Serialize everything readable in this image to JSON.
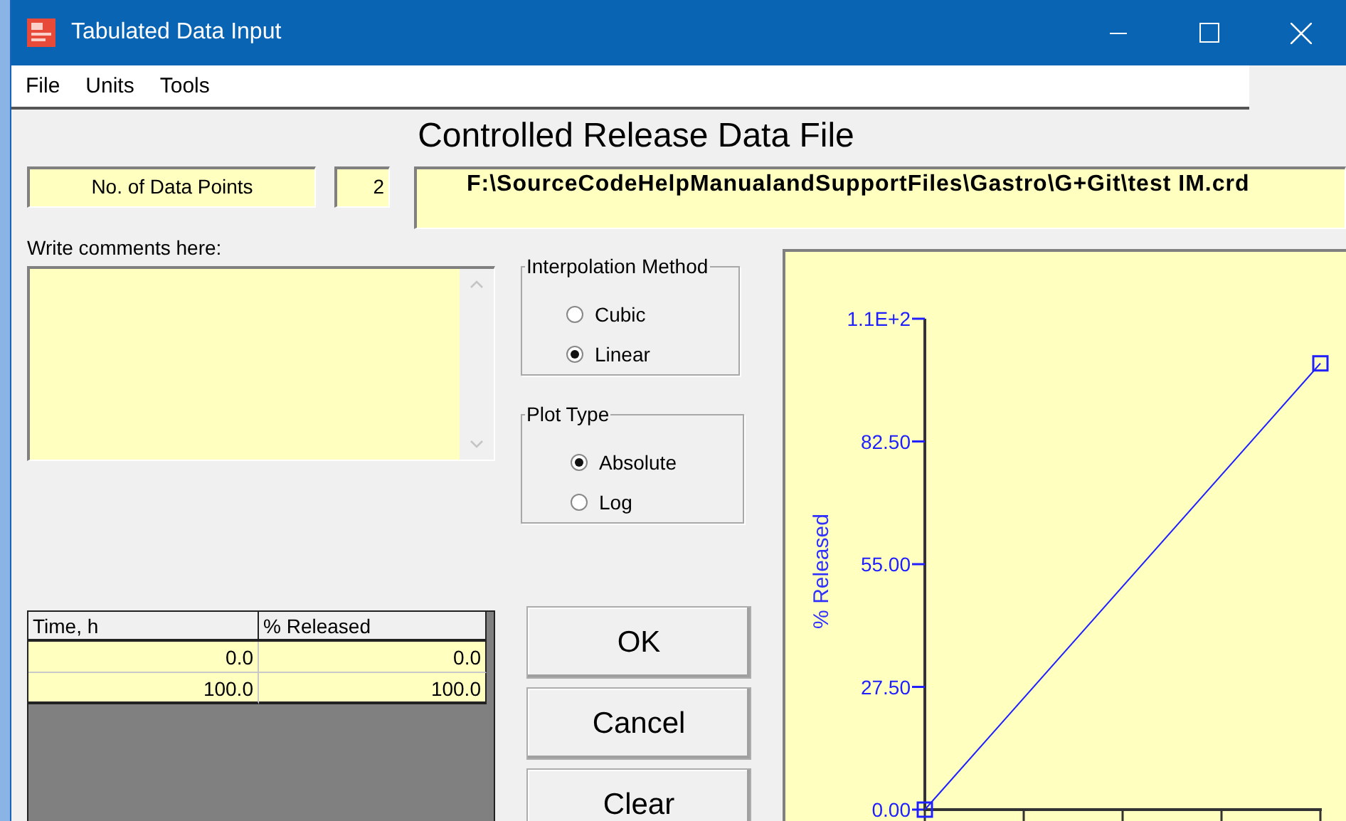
{
  "window": {
    "title": "Tabulated Data Input"
  },
  "menu": [
    {
      "label": "File"
    },
    {
      "label": "Units"
    },
    {
      "label": "Tools"
    }
  ],
  "heading": "Controlled Release Data File",
  "data_points": {
    "label": "No. of Data Points",
    "value": "2"
  },
  "file_path": "F:\\SourceCodeHelpManualandSupportFiles\\Gastro\\G+Git\\test IM.crd",
  "comments": {
    "label": "Write comments here:"
  },
  "interpolation": {
    "title": "Interpolation Method",
    "options": [
      {
        "label": "Cubic",
        "selected": false
      },
      {
        "label": "Linear",
        "selected": true
      }
    ]
  },
  "plot_type": {
    "title": "Plot Type",
    "options": [
      {
        "label": "Absolute",
        "selected": true
      },
      {
        "label": "Log",
        "selected": false
      }
    ]
  },
  "table": {
    "columns": [
      "Time, h",
      "% Released"
    ],
    "rows": [
      [
        "0.0",
        "0.0"
      ],
      [
        "100.0",
        "100.0"
      ]
    ]
  },
  "buttons": [
    {
      "label": "OK"
    },
    {
      "label": "Cancel"
    },
    {
      "label": "Clear"
    }
  ],
  "chart": {
    "axis_title": "% Released",
    "tick_labels": [
      "1.1E+2",
      "82.50",
      "55.00",
      "27.50",
      "0.00"
    ]
  }
}
